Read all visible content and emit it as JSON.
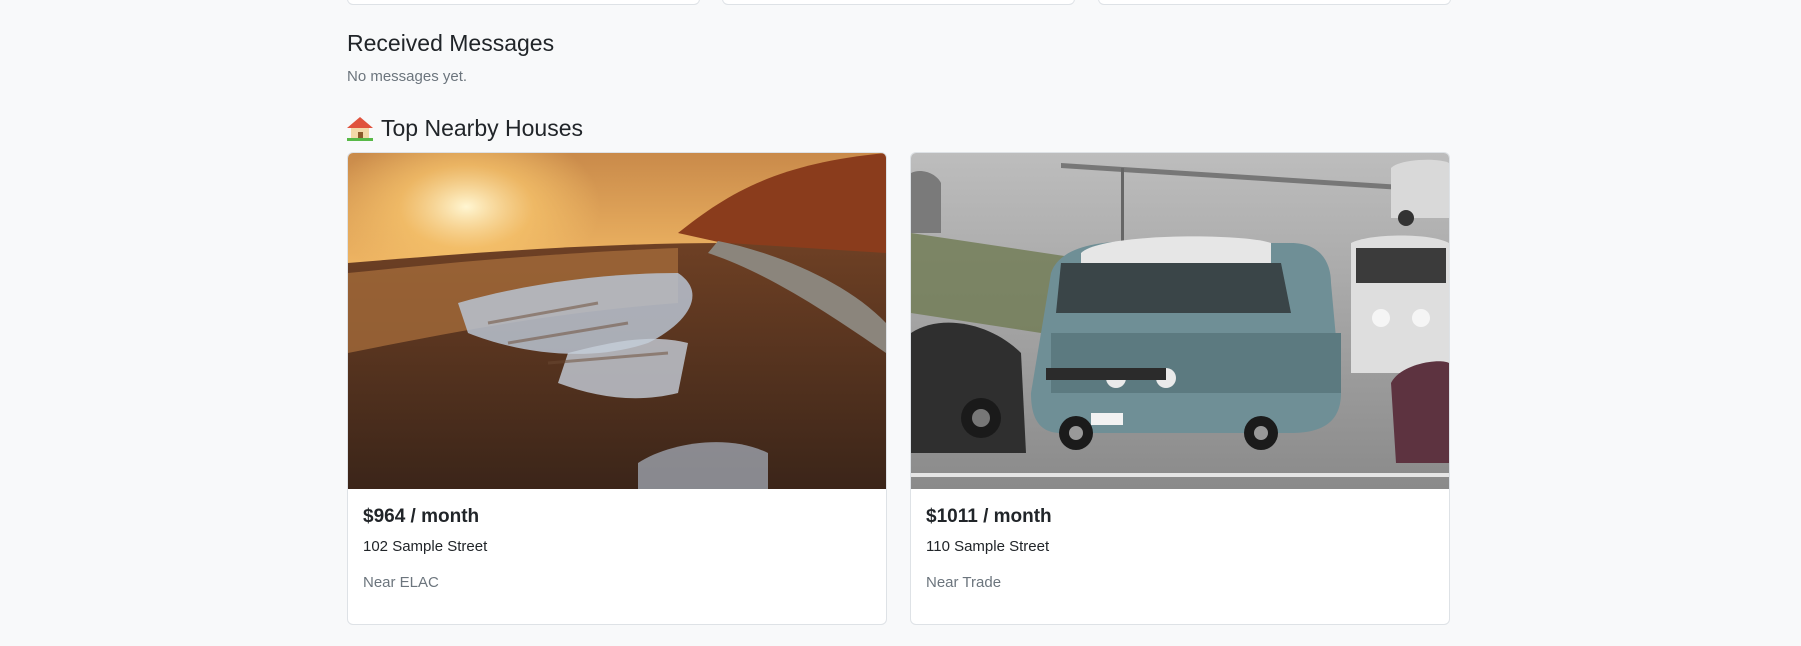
{
  "messages": {
    "title": "Received Messages",
    "empty_text": "No messages yet."
  },
  "nearby": {
    "icon": "house-icon",
    "title": "Top Nearby Houses",
    "houses": [
      {
        "price": "$964 / month",
        "address": "102 Sample Street",
        "near": "Near ELAC",
        "image_alt": "Sunset over a muddy road with puddles"
      },
      {
        "price": "$1011 / month",
        "address": "110 Sample Street",
        "near": "Near Trade",
        "image_alt": "Vintage blue van in a parking lot"
      }
    ]
  }
}
